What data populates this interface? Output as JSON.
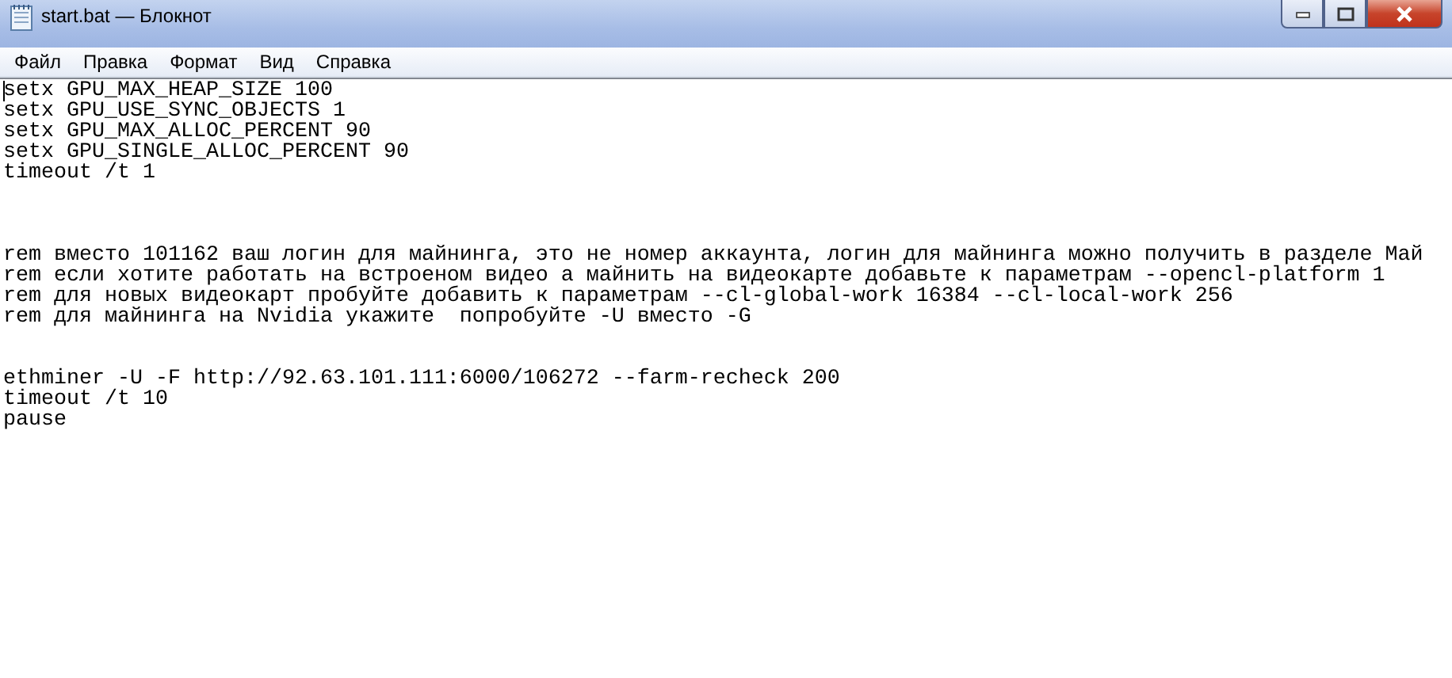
{
  "window": {
    "title": "start.bat — Блокнот"
  },
  "menu": [
    "Файл",
    "Правка",
    "Формат",
    "Вид",
    "Справка"
  ],
  "editor": {
    "lines": [
      {
        "kind": "text",
        "text": "setx GPU_MAX_HEAP_SIZE 100"
      },
      {
        "kind": "text",
        "text": "setx GPU_USE_SYNC_OBJECTS 1"
      },
      {
        "kind": "text",
        "text": "setx GPU_MAX_ALLOC_PERCENT 90"
      },
      {
        "kind": "text",
        "text": "setx GPU_SINGLE_ALLOC_PERCENT 90"
      },
      {
        "kind": "text",
        "text": "timeout /t 1"
      },
      {
        "kind": "blank"
      },
      {
        "kind": "blank"
      },
      {
        "kind": "blank"
      },
      {
        "kind": "text",
        "text": "rem вместо 101162 ваш логин для майнинга, это не номер аккаунта, логин для майнинга можно получить в разделе Май"
      },
      {
        "kind": "text",
        "text": "rem если хотите работать на встроеном видео а майнить на видеокарте добавьте к параметрам --opencl-platform 1"
      },
      {
        "kind": "text",
        "text": "rem для новых видеокарт пробуйте добавить к параметрам --cl-global-work 16384 --cl-local-work 256"
      },
      {
        "kind": "text",
        "text": "rem для майнинга на Nvidia укажите  попробуйте -U вместо -G"
      },
      {
        "kind": "blank"
      },
      {
        "kind": "blank"
      },
      {
        "kind": "text",
        "text": "ethminer -U -F http://92.63.101.111:6000/106272 --farm-recheck 200"
      },
      {
        "kind": "text",
        "text": "timeout /t 10"
      },
      {
        "kind": "text",
        "text": "pause"
      }
    ]
  }
}
